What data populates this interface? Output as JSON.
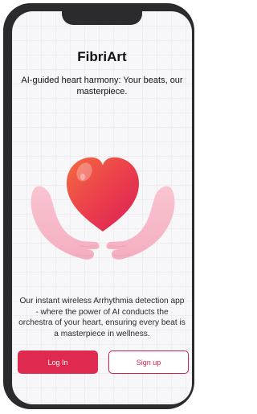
{
  "app": {
    "title": "FibriArt",
    "tagline": "AI-guided heart harmony: Your beats, our masterpiece.",
    "description": "Our instant wireless Arrhythmia detection app - where the power of AI conducts the orchestra of your heart, ensuring every beat is a masterpiece in wellness."
  },
  "illustration": {
    "icon": "heart-in-hands-icon",
    "heart_color": "#e8344f",
    "hands_color": "#f6b8c7"
  },
  "actions": {
    "login_label": "Log In",
    "signup_label": "Sign up"
  },
  "colors": {
    "accent": "#e0294f",
    "frame": "#2b2b2e",
    "background": "#f7f6f8"
  }
}
